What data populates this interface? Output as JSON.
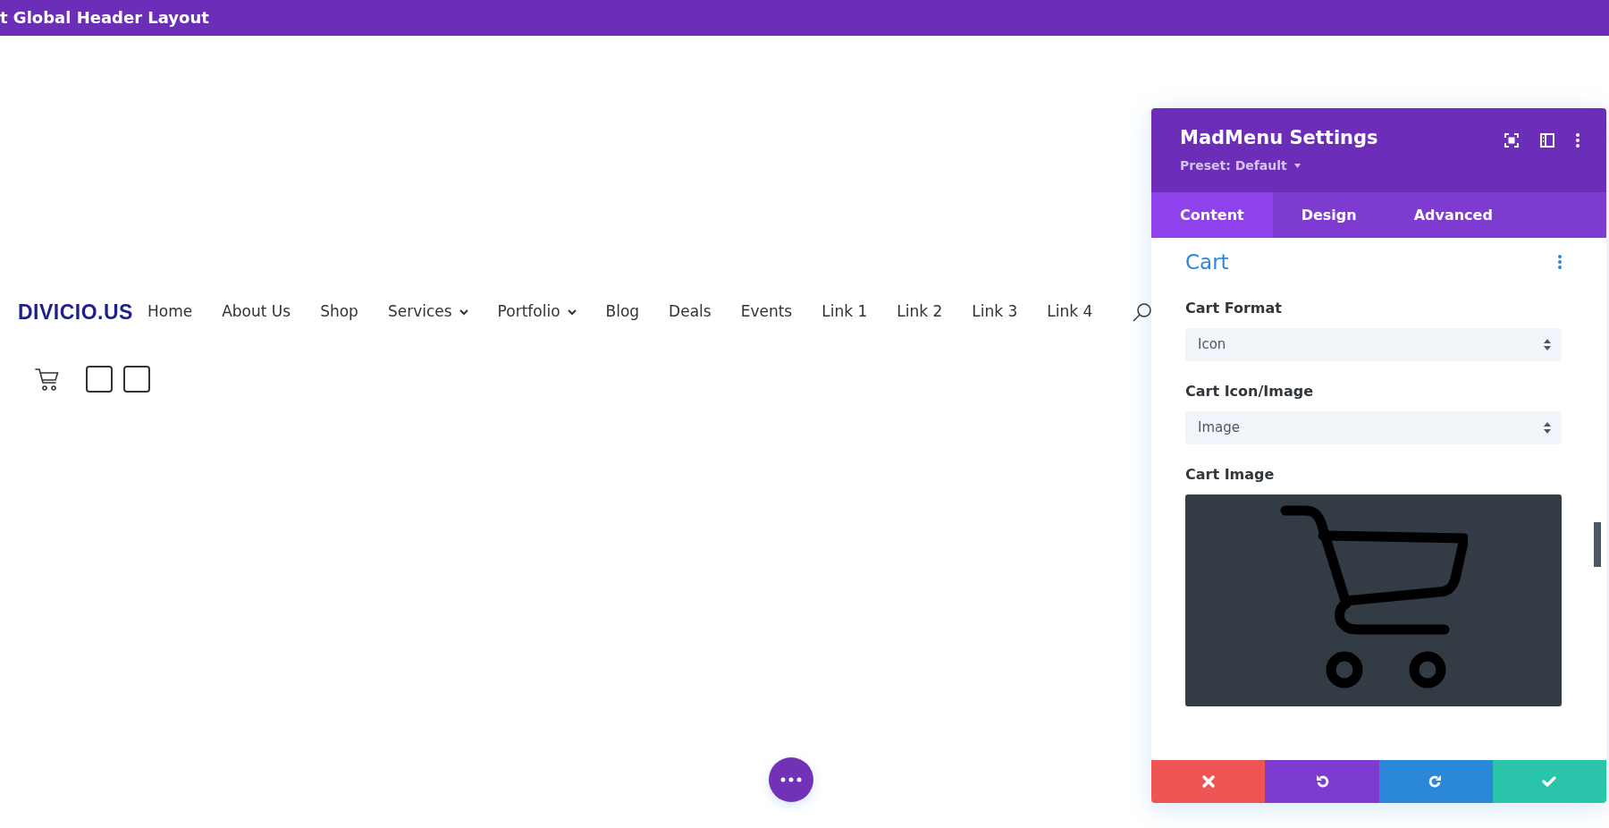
{
  "top_bar": {
    "title": "t Global Header Layout"
  },
  "header": {
    "logo": "DIVICIO.US",
    "menu": [
      {
        "label": "Home",
        "has_submenu": false
      },
      {
        "label": "About Us",
        "has_submenu": false
      },
      {
        "label": "Shop",
        "has_submenu": false
      },
      {
        "label": "Services",
        "has_submenu": true
      },
      {
        "label": "Portfolio",
        "has_submenu": true
      },
      {
        "label": "Blog",
        "has_submenu": false
      },
      {
        "label": "Deals",
        "has_submenu": false
      },
      {
        "label": "Events",
        "has_submenu": false
      },
      {
        "label": "Link 1",
        "has_submenu": false
      },
      {
        "label": "Link 2",
        "has_submenu": false
      },
      {
        "label": "Link 3",
        "has_submenu": false
      },
      {
        "label": "Link 4",
        "has_submenu": false
      }
    ]
  },
  "settings_panel": {
    "title": "MadMenu Settings",
    "preset": "Preset: Default",
    "tabs": [
      {
        "label": "Content",
        "selected": true
      },
      {
        "label": "Design",
        "selected": false
      },
      {
        "label": "Advanced",
        "selected": false
      }
    ],
    "section_title": "Cart",
    "fields": [
      {
        "kind": "select",
        "label": "Cart Format",
        "value": "Icon"
      },
      {
        "kind": "select",
        "label": "Cart Icon/Image",
        "value": "Image"
      },
      {
        "kind": "image",
        "label": "Cart Image"
      }
    ],
    "actions": [
      {
        "kind": "discard",
        "color": "#ef5555"
      },
      {
        "kind": "undo",
        "color": "#7e3bd0"
      },
      {
        "kind": "redo",
        "color": "#2b87da"
      },
      {
        "kind": "save",
        "color": "#29c4a9"
      }
    ]
  }
}
